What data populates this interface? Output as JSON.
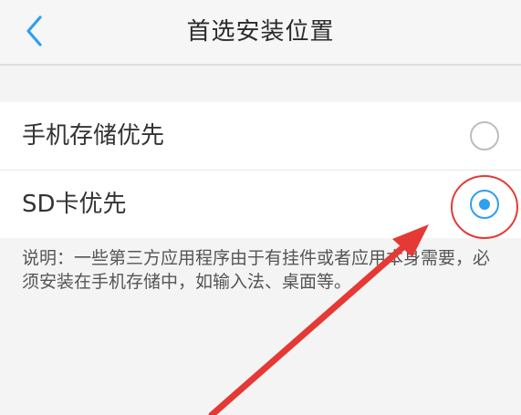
{
  "header": {
    "title": "首选安装位置",
    "back_icon": "chevron-left-icon"
  },
  "options": [
    {
      "label": "手机存储优先",
      "selected": false
    },
    {
      "label": "SD卡优先",
      "selected": true
    }
  ],
  "note": "说明：一些第三方应用程序由于有挂件或者应用本身需要，必须安装在手机存储中，如输入法、桌面等。",
  "colors": {
    "accent": "#2f9ff0",
    "annotation": "#e53935"
  }
}
